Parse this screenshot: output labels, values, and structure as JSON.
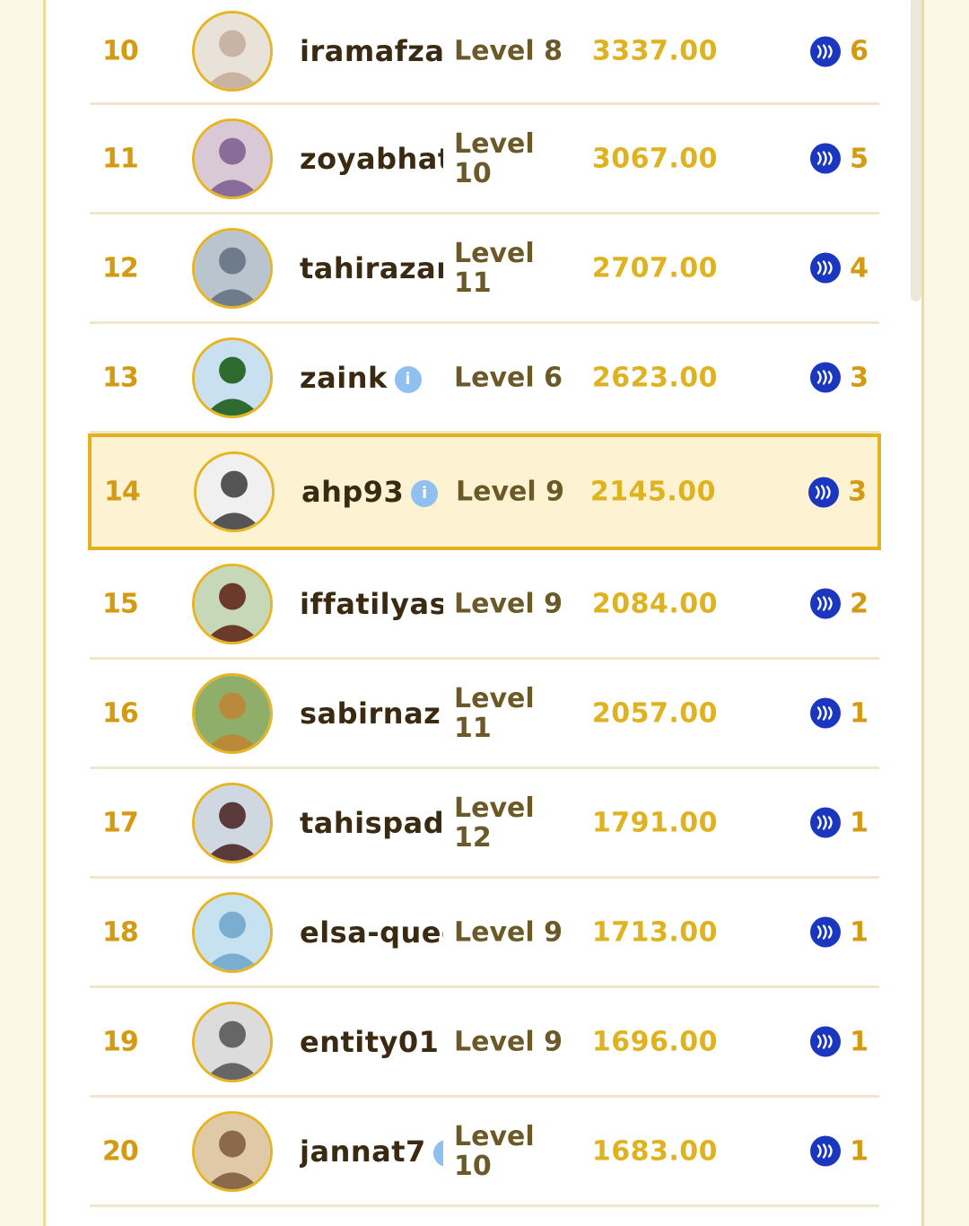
{
  "colors": {
    "rank": "#d39a12",
    "score": "#dfb21f",
    "name": "#3a2a12",
    "level": "#6b5a28",
    "highlight_bg": "#fdf3d3",
    "highlight_border": "#e2b31c",
    "steem_blue": "#1b36bf"
  },
  "rows": [
    {
      "rank": "10",
      "name": "iramafzal",
      "info": false,
      "level": "Level 8",
      "score": "3337.00",
      "reward": "6",
      "avatar": "avatar-image",
      "highlight": false
    },
    {
      "rank": "11",
      "name": "zoyabhatti",
      "info": false,
      "level": "Level 10",
      "score": "3067.00",
      "reward": "5",
      "avatar": "avatar-image",
      "highlight": false
    },
    {
      "rank": "12",
      "name": "tahirazam",
      "info": false,
      "level": "Level 11",
      "score": "2707.00",
      "reward": "4",
      "avatar": "avatar-image",
      "highlight": false
    },
    {
      "rank": "13",
      "name": "zaink",
      "info": true,
      "level": "Level 6",
      "score": "2623.00",
      "reward": "3",
      "avatar": "avatar-image",
      "highlight": false
    },
    {
      "rank": "14",
      "name": "ahp93",
      "info": true,
      "level": "Level 9",
      "score": "2145.00",
      "reward": "3",
      "avatar": "avatar-image",
      "highlight": true
    },
    {
      "rank": "15",
      "name": "iffatilyas",
      "info": false,
      "level": "Level 9",
      "score": "2084.00",
      "reward": "2",
      "avatar": "avatar-image",
      "highlight": false
    },
    {
      "rank": "16",
      "name": "sabirnaz",
      "info": true,
      "level": "Level 11",
      "score": "2057.00",
      "reward": "1",
      "avatar": "avatar-image",
      "highlight": false
    },
    {
      "rank": "17",
      "name": "tahispadr",
      "info": false,
      "level": "Level 12",
      "score": "1791.00",
      "reward": "1",
      "avatar": "avatar-image",
      "highlight": false
    },
    {
      "rank": "18",
      "name": "elsa-queen",
      "info": false,
      "level": "Level 9",
      "score": "1713.00",
      "reward": "1",
      "avatar": "avatar-image",
      "highlight": false
    },
    {
      "rank": "19",
      "name": "entity01",
      "info": true,
      "level": "Level 9",
      "score": "1696.00",
      "reward": "1",
      "avatar": "avatar-image",
      "highlight": false
    },
    {
      "rank": "20",
      "name": "jannat7",
      "info": true,
      "level": "Level 10",
      "score": "1683.00",
      "reward": "1",
      "avatar": "avatar-image",
      "highlight": false
    }
  ]
}
